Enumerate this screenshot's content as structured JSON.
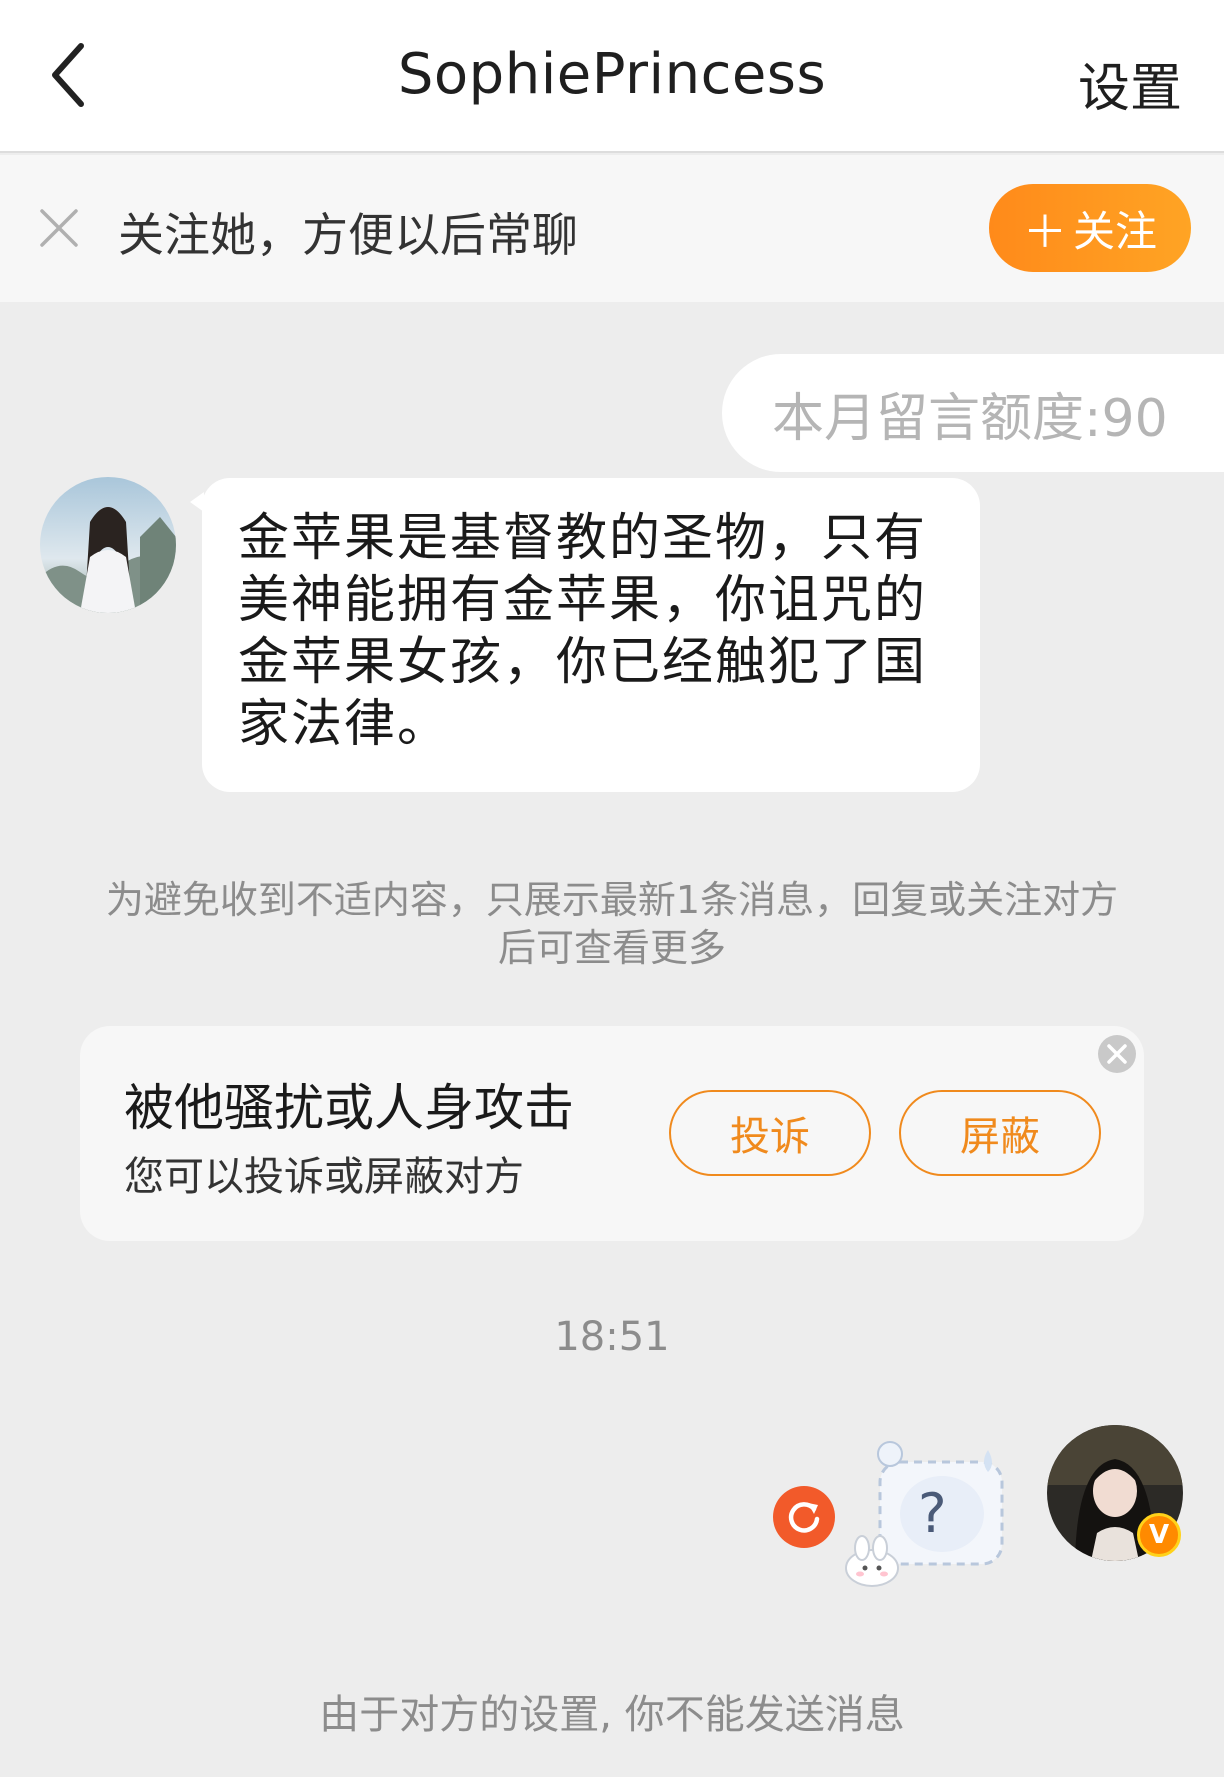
{
  "header": {
    "back_icon": "chevron-left-icon",
    "title": "SophiePrincess",
    "settings_label": "设置"
  },
  "follow_banner": {
    "close_icon": "close-icon",
    "text": "关注她，方便以后常聊",
    "follow_plus": "＋",
    "follow_label": "关注",
    "accent": "#ff9a1f"
  },
  "quota": {
    "text": "本月留言额度:90"
  },
  "incoming_message": {
    "avatar": "avatar",
    "text": "金苹果是基督教的圣物，只有美神能拥有金苹果，你诅咒的金苹果女孩，你已经触犯了国家法律。"
  },
  "notice": {
    "text": "为避免收到不适内容，只展示最新1条消息，回复或关注对方后可查看更多"
  },
  "report_card": {
    "close_icon": "close-circle-icon",
    "title": "被他骚扰或人身攻击",
    "subtitle": "您可以投诉或屏蔽对方",
    "complain_label": "投诉",
    "block_label": "屏蔽",
    "accent": "#f08a1d"
  },
  "timestamp": "18:51",
  "outgoing_message": {
    "resend_icon": "refresh-icon",
    "sticker_icon": "question-sticker-icon",
    "sticker_text": "?",
    "avatar": "avatar",
    "badge_text": "V"
  },
  "footer": {
    "text": "由于对方的设置, 你不能发送消息"
  }
}
